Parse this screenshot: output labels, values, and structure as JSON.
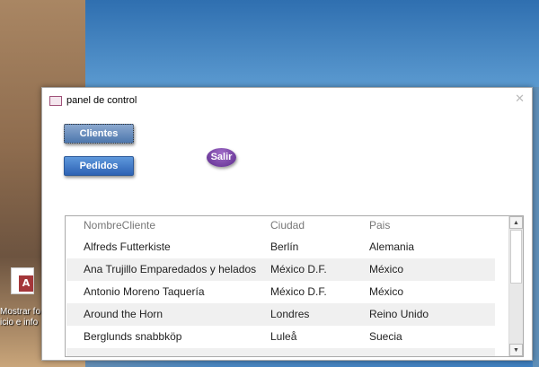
{
  "desktop": {
    "icon_label_line1": "Mostrar fo",
    "icon_label_line2": "icio e info",
    "icon_glyph": "A"
  },
  "window": {
    "title": "panel de control",
    "close": "✕"
  },
  "buttons": {
    "clientes": "Clientes",
    "pedidos": "Pedidos",
    "salir": "Salir"
  },
  "list": {
    "columns": [
      "NombreCliente",
      "Ciudad",
      "Pais"
    ],
    "rows": [
      [
        "Alfreds Futterkiste",
        "Berlín",
        "Alemania"
      ],
      [
        "Ana Trujillo Emparedados y helados",
        "México D.F.",
        "México"
      ],
      [
        "Antonio Moreno Taquería",
        "México D.F.",
        "México"
      ],
      [
        "Around the Horn",
        "Londres",
        "Reino Unido"
      ],
      [
        "Berglunds snabbköp",
        "Luleå",
        "Suecia"
      ]
    ]
  },
  "scrollbar": {
    "up": "▲",
    "down": "▼"
  }
}
